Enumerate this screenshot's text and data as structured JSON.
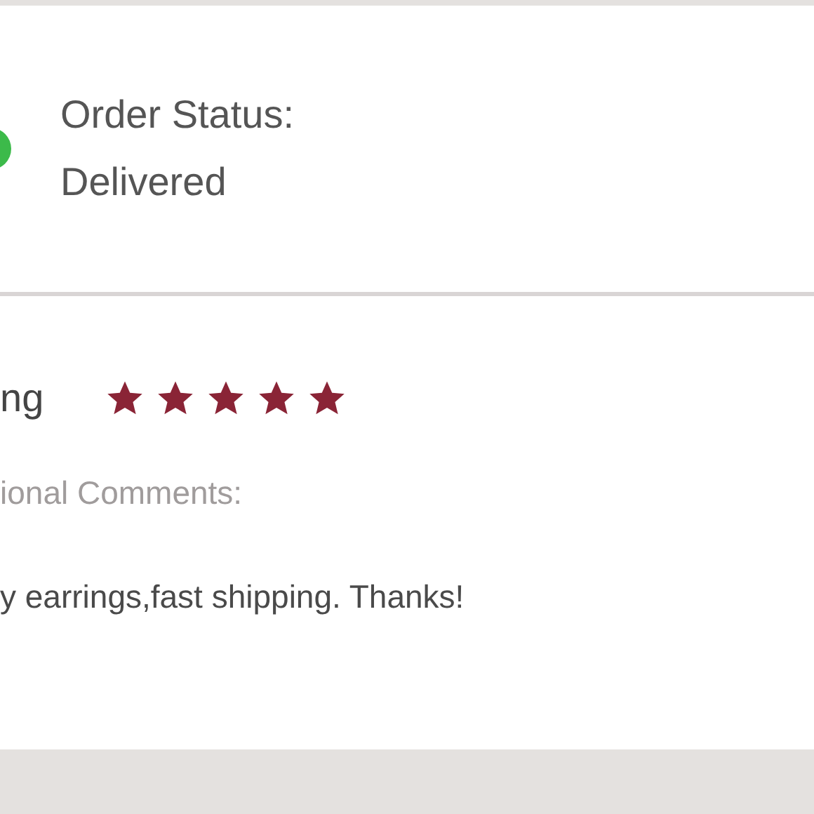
{
  "order_status": {
    "label": "Order Status:",
    "value": "Delivered",
    "color": "#3cba4a"
  },
  "review": {
    "rating_label": "ng",
    "stars": 5,
    "comments_label": "ional Comments:",
    "comment": "y earrings,fast shipping. Thanks!"
  }
}
